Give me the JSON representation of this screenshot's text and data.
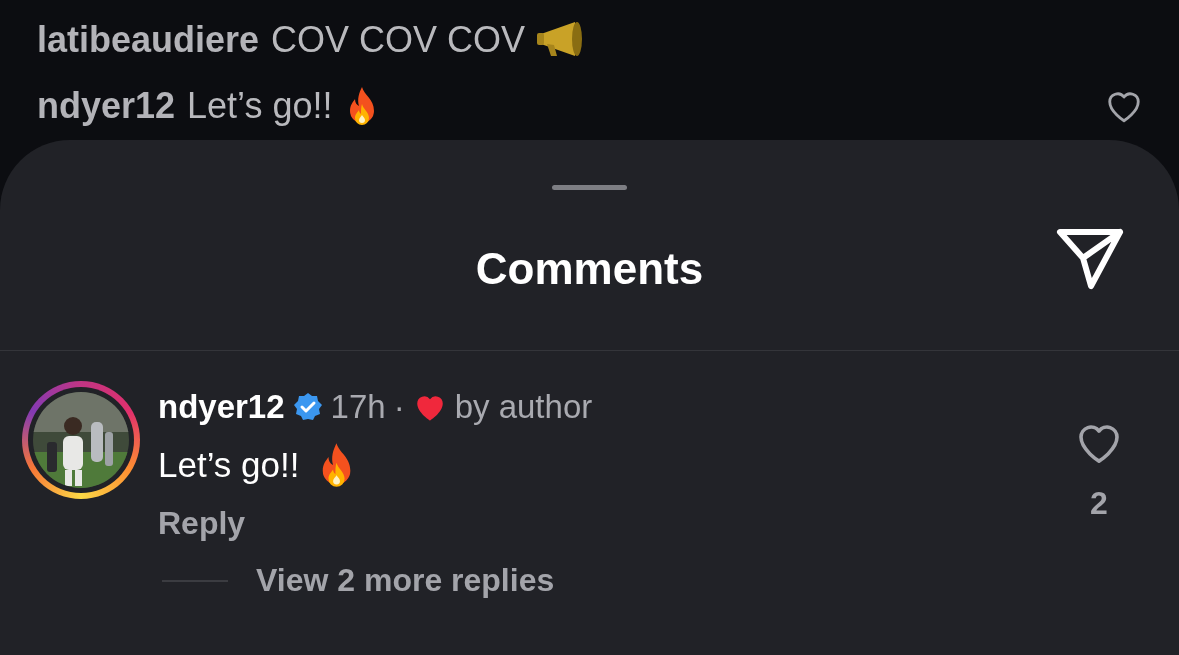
{
  "feed_comments": [
    {
      "username": "latibeaudiere",
      "text": "COV COV COV",
      "emoji": {
        "kind": "megaphone"
      },
      "like_button": false
    },
    {
      "username": "ndyer12",
      "text": "Let’s go!!",
      "emoji": {
        "kind": "fire"
      },
      "like_button": true
    }
  ],
  "sheet": {
    "title": "Comments",
    "comment": {
      "username": "ndyer12",
      "verified": true,
      "time": "17h",
      "separator": "·",
      "liked_by_author": true,
      "author_label": "by author",
      "text": "Let’s go!!",
      "emoji": {
        "kind": "fire"
      },
      "reply": "Reply",
      "like_count": "2",
      "liked": false,
      "view_replies": "View 2 more replies"
    }
  }
}
